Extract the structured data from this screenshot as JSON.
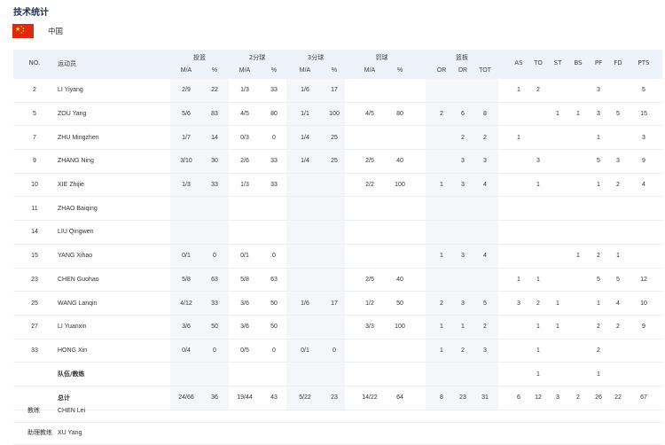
{
  "page": {
    "title": "技术统计"
  },
  "team": {
    "name": "中国"
  },
  "header": {
    "no": "NO.",
    "player": "运动员",
    "groups": [
      "投篮",
      "2分球",
      "3分球",
      "罚球",
      "篮板"
    ],
    "ma": "M/A",
    "pct": "%",
    "reb": [
      "OR",
      "DR",
      "TOT"
    ],
    "stats": [
      "AS",
      "TO",
      "ST",
      "BS",
      "PF",
      "FD",
      "PTS"
    ]
  },
  "rows": [
    {
      "no": "2",
      "name": "LI Yiyang",
      "fg": "2/9",
      "fgp": "22",
      "p2": "1/3",
      "p2p": "33",
      "p3": "1/6",
      "p3p": "17",
      "ft": "",
      "ftp": "",
      "or": "",
      "dr": "",
      "tot": "",
      "as": "1",
      "to": "2",
      "st": "",
      "bs": "",
      "pf": "3",
      "fd": "",
      "pts": "5"
    },
    {
      "no": "5",
      "name": "ZOU Yang",
      "fg": "5/6",
      "fgp": "83",
      "p2": "4/5",
      "p2p": "80",
      "p3": "1/1",
      "p3p": "100",
      "ft": "4/5",
      "ftp": "80",
      "or": "2",
      "dr": "6",
      "tot": "8",
      "as": "",
      "to": "",
      "st": "1",
      "bs": "1",
      "pf": "3",
      "fd": "5",
      "pts": "15"
    },
    {
      "no": "7",
      "name": "ZHU Mingzhen",
      "fg": "1/7",
      "fgp": "14",
      "p2": "0/3",
      "p2p": "0",
      "p3": "1/4",
      "p3p": "25",
      "ft": "",
      "ftp": "",
      "or": "",
      "dr": "2",
      "tot": "2",
      "as": "1",
      "to": "",
      "st": "",
      "bs": "",
      "pf": "1",
      "fd": "",
      "pts": "3"
    },
    {
      "no": "9",
      "name": "ZHANG Ning",
      "fg": "3/10",
      "fgp": "30",
      "p2": "2/6",
      "p2p": "33",
      "p3": "1/4",
      "p3p": "25",
      "ft": "2/5",
      "ftp": "40",
      "or": "",
      "dr": "3",
      "tot": "3",
      "as": "",
      "to": "3",
      "st": "",
      "bs": "",
      "pf": "5",
      "fd": "3",
      "pts": "9"
    },
    {
      "no": "10",
      "name": "XIE Zhijie",
      "fg": "1/3",
      "fgp": "33",
      "p2": "1/3",
      "p2p": "33",
      "p3": "",
      "p3p": "",
      "ft": "2/2",
      "ftp": "100",
      "or": "1",
      "dr": "3",
      "tot": "4",
      "as": "",
      "to": "1",
      "st": "",
      "bs": "",
      "pf": "1",
      "fd": "2",
      "pts": "4"
    },
    {
      "no": "11",
      "name": "ZHAO Baiqing",
      "fg": "",
      "fgp": "",
      "p2": "",
      "p2p": "",
      "p3": "",
      "p3p": "",
      "ft": "",
      "ftp": "",
      "or": "",
      "dr": "",
      "tot": "",
      "as": "",
      "to": "",
      "st": "",
      "bs": "",
      "pf": "",
      "fd": "",
      "pts": ""
    },
    {
      "no": "14",
      "name": "LIU Qingwen",
      "fg": "",
      "fgp": "",
      "p2": "",
      "p2p": "",
      "p3": "",
      "p3p": "",
      "ft": "",
      "ftp": "",
      "or": "",
      "dr": "",
      "tot": "",
      "as": "",
      "to": "",
      "st": "",
      "bs": "",
      "pf": "",
      "fd": "",
      "pts": ""
    },
    {
      "no": "15",
      "name": "YANG Xihao",
      "fg": "0/1",
      "fgp": "0",
      "p2": "0/1",
      "p2p": "0",
      "p3": "",
      "p3p": "",
      "ft": "",
      "ftp": "",
      "or": "1",
      "dr": "3",
      "tot": "4",
      "as": "",
      "to": "",
      "st": "",
      "bs": "1",
      "pf": "2",
      "fd": "1",
      "pts": ""
    },
    {
      "no": "23",
      "name": "CHEN Guohao",
      "fg": "5/8",
      "fgp": "63",
      "p2": "5/8",
      "p2p": "63",
      "p3": "",
      "p3p": "",
      "ft": "2/5",
      "ftp": "40",
      "or": "",
      "dr": "",
      "tot": "",
      "as": "1",
      "to": "1",
      "st": "",
      "bs": "",
      "pf": "5",
      "fd": "5",
      "pts": "12"
    },
    {
      "no": "25",
      "name": "WANG Lanqin",
      "fg": "4/12",
      "fgp": "33",
      "p2": "3/6",
      "p2p": "50",
      "p3": "1/6",
      "p3p": "17",
      "ft": "1/2",
      "ftp": "50",
      "or": "2",
      "dr": "3",
      "tot": "5",
      "as": "3",
      "to": "2",
      "st": "1",
      "bs": "",
      "pf": "1",
      "fd": "4",
      "pts": "10"
    },
    {
      "no": "27",
      "name": "LI Yuanxin",
      "fg": "3/6",
      "fgp": "50",
      "p2": "3/6",
      "p2p": "50",
      "p3": "",
      "p3p": "",
      "ft": "3/3",
      "ftp": "100",
      "or": "1",
      "dr": "1",
      "tot": "2",
      "as": "",
      "to": "1",
      "st": "1",
      "bs": "",
      "pf": "2",
      "fd": "2",
      "pts": "9"
    },
    {
      "no": "33",
      "name": "HONG Xin",
      "fg": "0/4",
      "fgp": "0",
      "p2": "0/5",
      "p2p": "0",
      "p3": "0/1",
      "p3p": "0",
      "ft": "",
      "ftp": "",
      "or": "1",
      "dr": "2",
      "tot": "3",
      "as": "",
      "to": "1",
      "st": "",
      "bs": "",
      "pf": "2",
      "fd": "",
      "pts": ""
    },
    {
      "no": "",
      "name": "队伍/教练",
      "fg": "",
      "fgp": "",
      "p2": "",
      "p2p": "",
      "p3": "",
      "p3p": "",
      "ft": "",
      "ftp": "",
      "or": "",
      "dr": "",
      "tot": "",
      "as": "",
      "to": "1",
      "st": "",
      "bs": "",
      "pf": "1",
      "fd": "",
      "pts": "",
      "bold": true
    },
    {
      "no": "",
      "name": "总计",
      "fg": "24/66",
      "fgp": "36",
      "p2": "19/44",
      "p2p": "43",
      "p3": "5/22",
      "p3p": "23",
      "ft": "14/22",
      "ftp": "64",
      "or": "8",
      "dr": "23",
      "tot": "31",
      "as": "6",
      "to": "12",
      "st": "3",
      "bs": "2",
      "pf": "26",
      "fd": "22",
      "pts": "67",
      "bold": true
    }
  ],
  "coaches": [
    {
      "role": "教练",
      "name": "CHEN Lei"
    },
    {
      "role": "助理教练",
      "name": "XU Yang"
    }
  ]
}
